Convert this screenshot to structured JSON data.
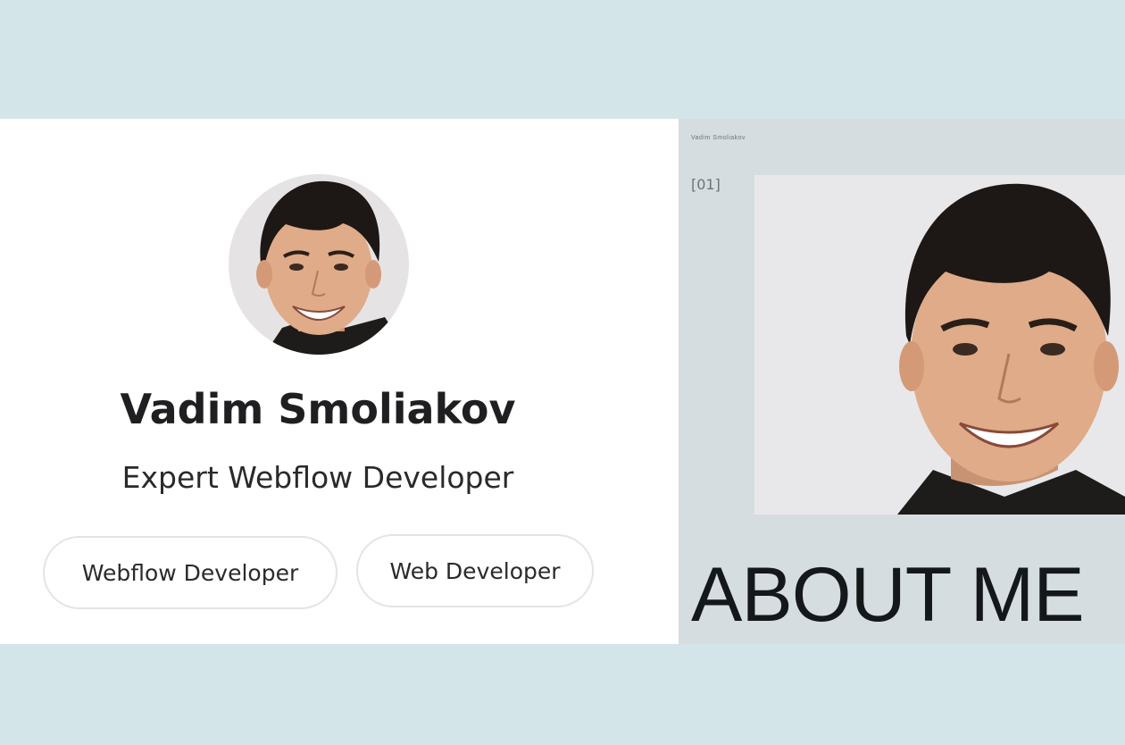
{
  "profile_card": {
    "name": "Vadim Smoliakov",
    "title": "Expert Webflow Developer",
    "tags": [
      "Webflow Developer",
      "Web Developer"
    ],
    "avatar_icon": "portrait-photo-icon"
  },
  "preview": {
    "header_text": "Vadim Smoliakov",
    "section_marker": "[01]",
    "section_title": "ABOUT ME",
    "photo_icon": "portrait-photo-icon"
  },
  "colors": {
    "page_background": "#d4e5ea",
    "card_background": "#ffffff",
    "preview_background": "#d5dde1",
    "text_dark": "#1f1f22"
  }
}
